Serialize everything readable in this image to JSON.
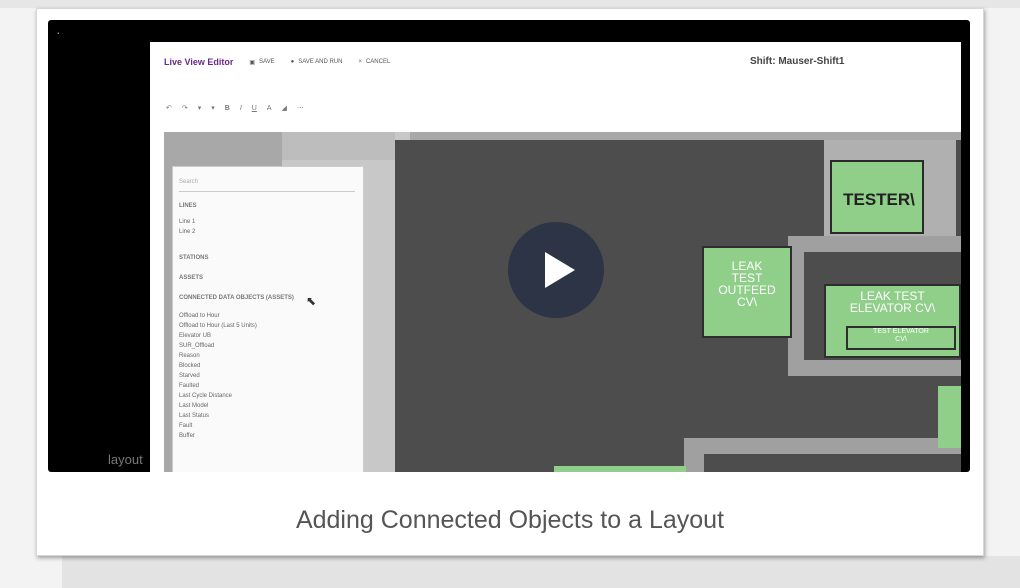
{
  "caption": "Adding Connected Objects to a Layout",
  "app": {
    "title": "Live View Editor",
    "save_label": "SAVE",
    "save_and_run_label": "SAVE AND RUN",
    "cancel_label": "CANCEL",
    "shift": "Shift: Mauser-Shift1"
  },
  "sidepanel": {
    "search_placeholder": "Search",
    "sections": [
      "LINES",
      "STATIONS",
      "ASSETS",
      "CONNECTED DATA OBJECTS (ASSETS)"
    ],
    "lines": [
      "Line 1",
      "Line 2"
    ],
    "objects": [
      "Offload to Hour",
      "Offload to Hour (Last 5 Units)",
      "Elevator UB",
      "SUR_Offload",
      "Reason",
      "Blocked",
      "Starved",
      "Faulted",
      "Last Cycle Distance",
      "Last Model",
      "Last Status",
      "Fault",
      "Buffer"
    ]
  },
  "canvas": {
    "tester": "TESTER\\",
    "leak_outfeed": [
      "LEAK",
      "TEST",
      "OUTFEED",
      "CV\\"
    ],
    "leak_elevator": [
      "LEAK TEST",
      "ELEVATOR CV\\"
    ],
    "elevator_inner": [
      "TEST ELEVATOR",
      "CV\\"
    ]
  },
  "left_overlay": "layout",
  "colors": {
    "green": "#8fcf8a",
    "dark_canvas": "#4d4d4d",
    "play_bg": "#2c3446",
    "title_purple": "#6a2a8a"
  }
}
